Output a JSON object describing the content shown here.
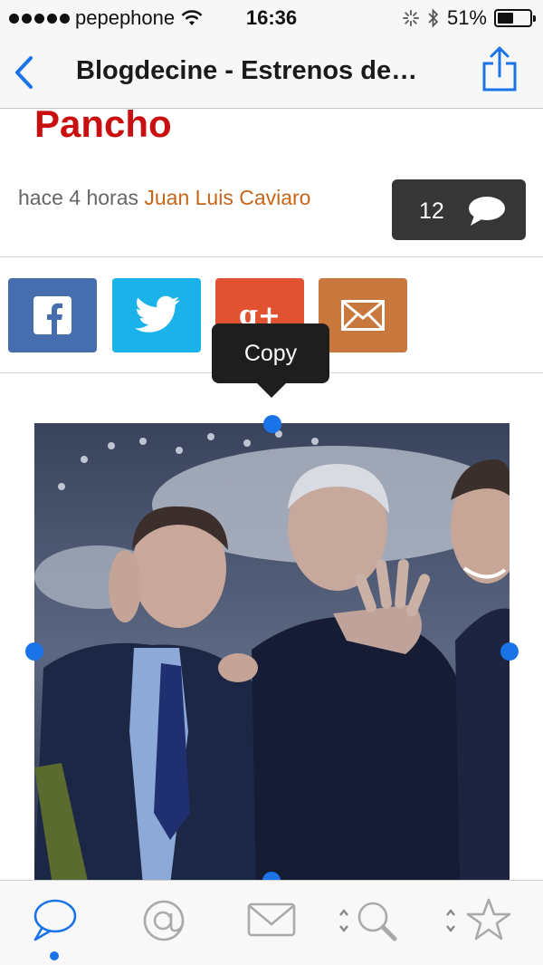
{
  "status_bar": {
    "carrier": "pepephone",
    "time": "16:36",
    "battery": "51%",
    "battery_level": 0.51,
    "icons": [
      "signal-dots-icon",
      "wifi-icon",
      "activity-spinner-icon",
      "bluetooth-icon",
      "battery-icon"
    ]
  },
  "nav": {
    "title": "Blogdecine - Estrenos de…",
    "back_icon": "chevron-left-icon",
    "share_icon": "share-icon"
  },
  "article": {
    "title": "Pancho",
    "time_ago": "hace 4 horas",
    "author": "Juan Luis Caviaro",
    "comment_count": "12",
    "comment_icon": "speech-bubble-icon"
  },
  "share_buttons": [
    {
      "name": "facebook",
      "icon": "facebook-icon",
      "color": "#466eaf"
    },
    {
      "name": "twitter",
      "icon": "twitter-bird-icon",
      "color": "#1ab2e8"
    },
    {
      "name": "google-plus",
      "icon": "google-plus-icon",
      "color": "#e15233",
      "label": "g+"
    },
    {
      "name": "email",
      "icon": "envelope-icon",
      "color": "#c8773d"
    }
  ],
  "context_menu": {
    "copy_label": "Copy"
  },
  "tab_bar": {
    "tabs": [
      {
        "icon": "speech-bubble-icon",
        "active": true
      },
      {
        "icon": "at-sign-icon",
        "active": false
      },
      {
        "icon": "envelope-icon",
        "active": false
      },
      {
        "icon": "magnifier-icon",
        "active": false
      },
      {
        "icon": "star-icon",
        "active": false
      }
    ],
    "accent_color": "#1a74e8"
  }
}
